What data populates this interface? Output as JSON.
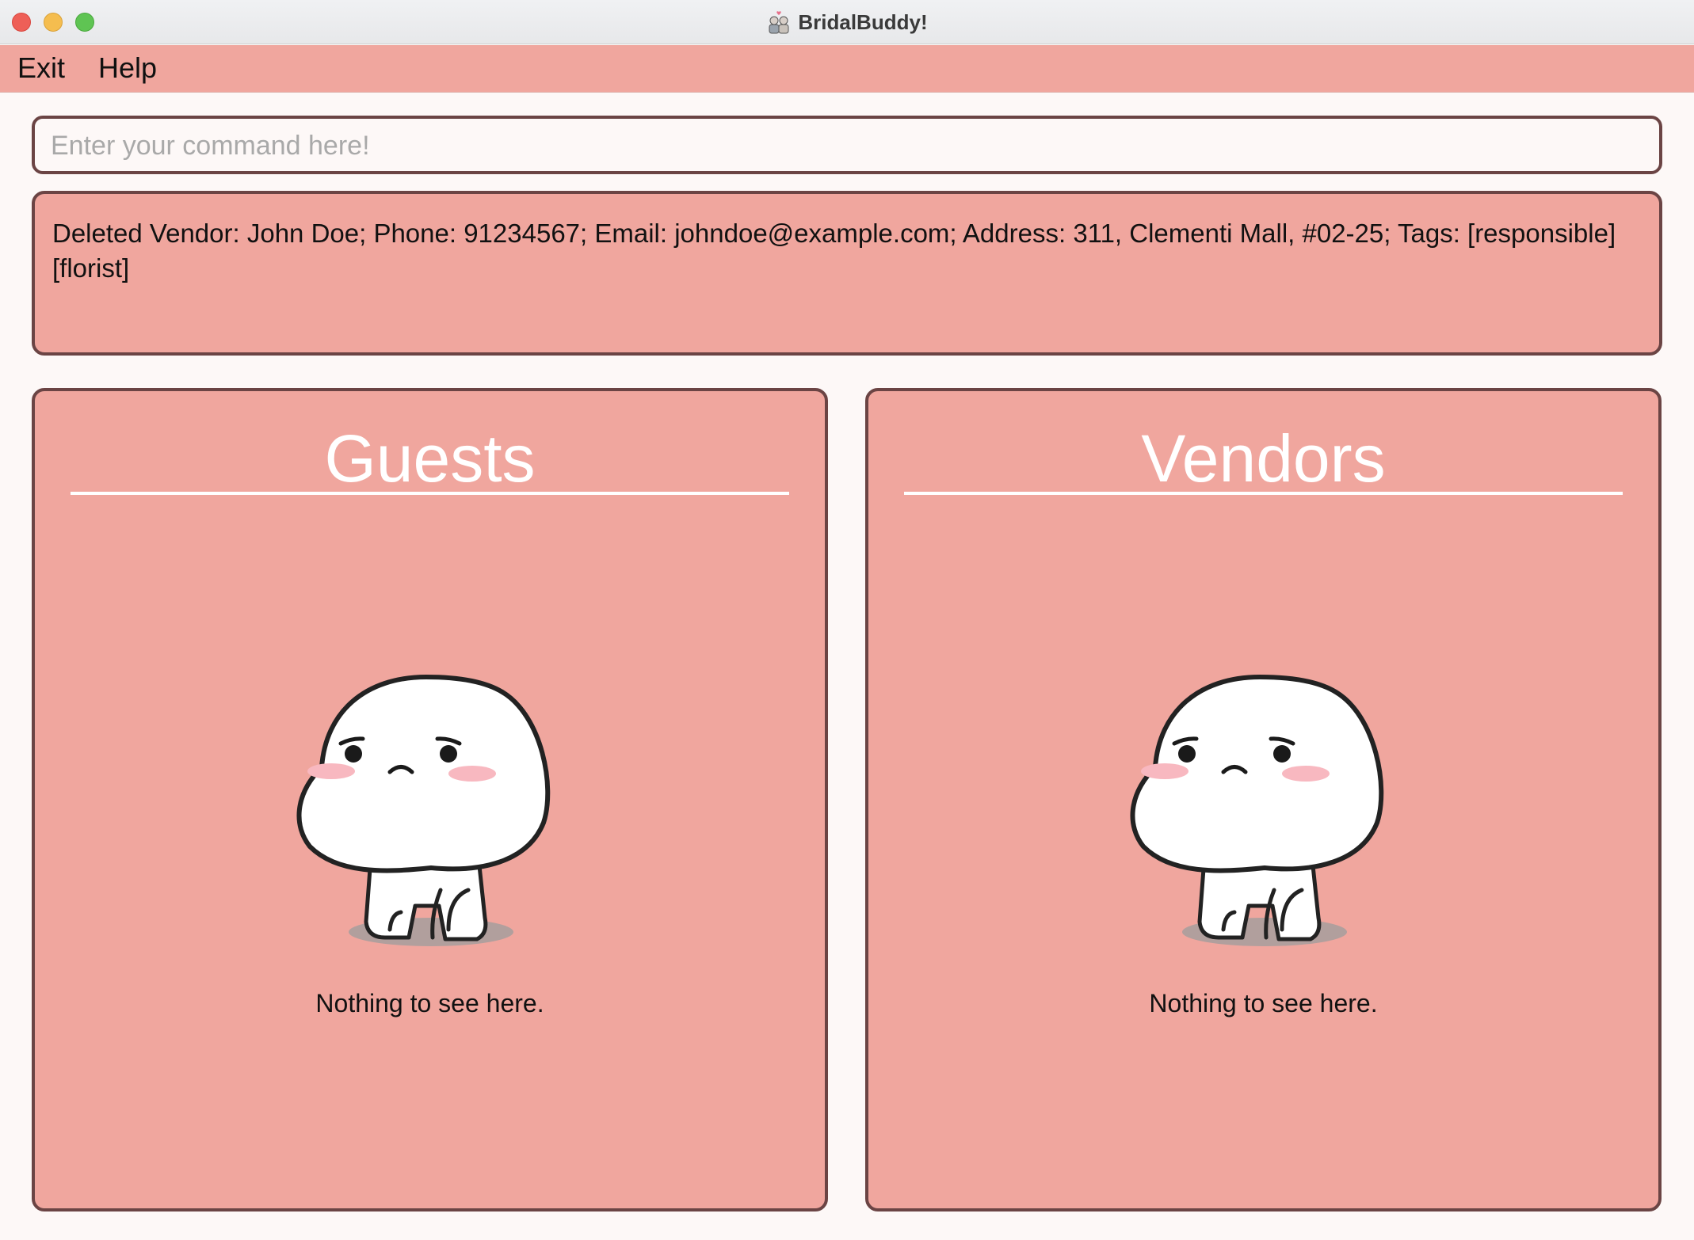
{
  "window": {
    "title": "BridalBuddy!",
    "app_icon": "couple-icon"
  },
  "menu": {
    "items": [
      {
        "label": "Exit"
      },
      {
        "label": "Help"
      }
    ]
  },
  "command": {
    "placeholder": "Enter your command here!",
    "value": ""
  },
  "result": {
    "text": "Deleted Vendor: John Doe; Phone: 91234567; Email: johndoe@example.com; Address: 311, Clementi Mall, #02-25; Tags: [responsible][florist]"
  },
  "panels": {
    "guests": {
      "title": "Guests",
      "empty_message": "Nothing to see here.",
      "illustration": "sad-mascot-icon"
    },
    "vendors": {
      "title": "Vendors",
      "empty_message": "Nothing to see here.",
      "illustration": "sad-mascot-icon"
    }
  },
  "colors": {
    "accent_pink": "#f0a69e",
    "border_brown": "#6b4444",
    "background": "#fdf8f7"
  }
}
